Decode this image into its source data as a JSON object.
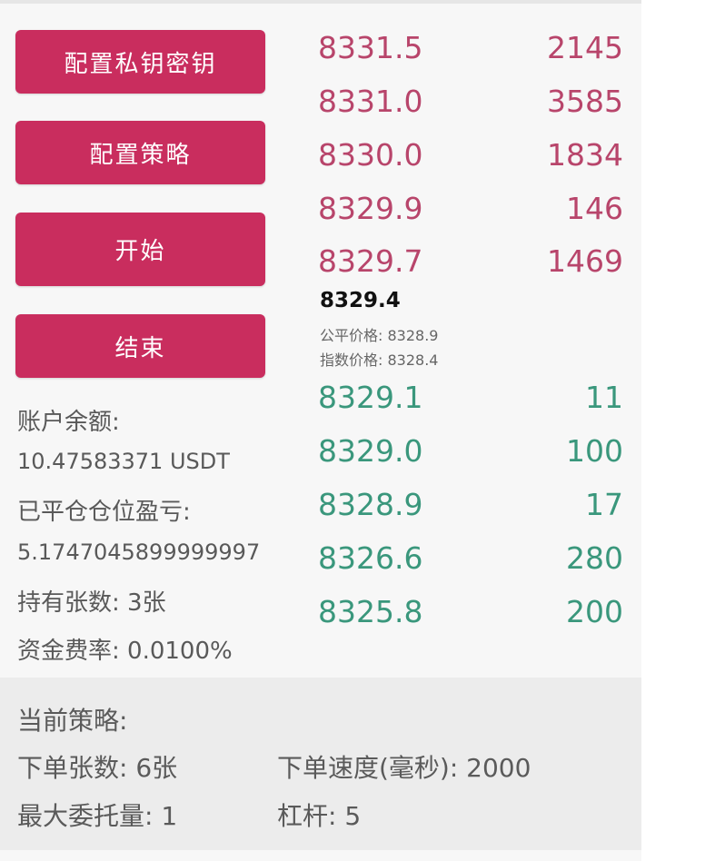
{
  "buttons": {
    "configure_keys": "配置私钥密钥",
    "configure_strategy": "配置策略",
    "start": "开始",
    "stop": "结束"
  },
  "account": {
    "balance_label": "账户余额:",
    "balance_value": "10.47583371 USDT",
    "closed_pnl_label": "已平仓仓位盈亏:",
    "closed_pnl_value": "5.1747045899999997",
    "holdings": "持有张数: 3张",
    "funding_rate": "资金费率: 0.0100%"
  },
  "orderbook": {
    "asks": [
      {
        "price": "8331.5",
        "size": "2145"
      },
      {
        "price": "8331.0",
        "size": "3585"
      },
      {
        "price": "8330.0",
        "size": "1834"
      },
      {
        "price": "8329.9",
        "size": "146"
      },
      {
        "price": "8329.7",
        "size": "1469"
      }
    ],
    "last_price": "8329.4",
    "fair_price": "公平价格: 8328.9",
    "index_price": "指数价格: 8328.4",
    "bids": [
      {
        "price": "8329.1",
        "size": "11"
      },
      {
        "price": "8329.0",
        "size": "100"
      },
      {
        "price": "8328.9",
        "size": "17"
      },
      {
        "price": "8326.6",
        "size": "280"
      },
      {
        "price": "8325.8",
        "size": "200"
      }
    ],
    "ask_color": "#b8456b",
    "bid_color": "#3a977c"
  },
  "strategy": {
    "title": "当前策略:",
    "order_qty": "下单张数: 6张",
    "order_speed": "下单速度(毫秒): 2000",
    "max_orders": "最大委托量: 1",
    "leverage": "杠杆: 5"
  },
  "colors": {
    "button_bg": "#c92d5e",
    "panel_bg": "#f7f7f7",
    "strategy_bg": "#ececec"
  }
}
